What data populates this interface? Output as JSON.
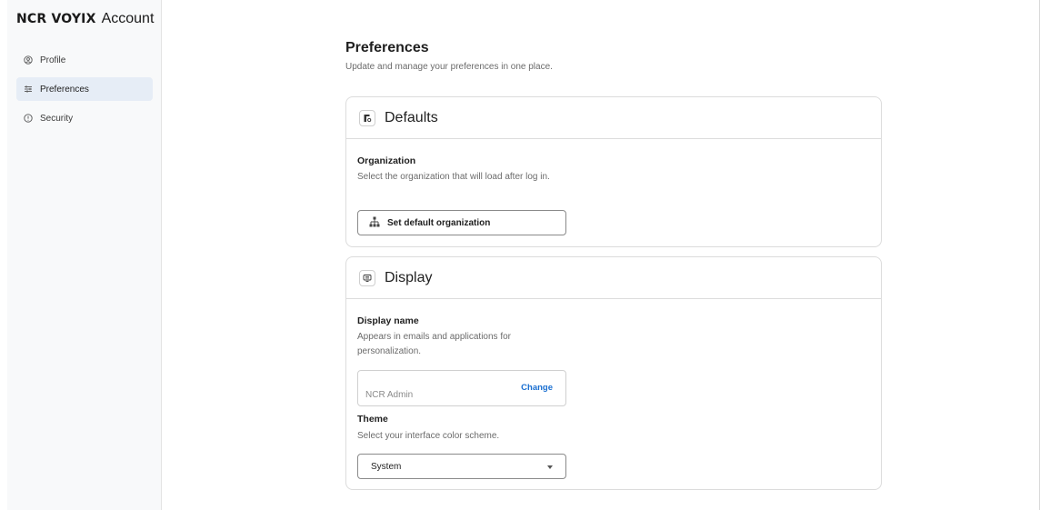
{
  "brand": {
    "logo_text": "NCR VOYIX",
    "name": "Account"
  },
  "sidebar": {
    "items": [
      {
        "label": "Profile",
        "icon": "user-circle-icon",
        "active": false
      },
      {
        "label": "Preferences",
        "icon": "sliders-icon",
        "active": true
      },
      {
        "label": "Security",
        "icon": "shield-icon",
        "active": false
      }
    ]
  },
  "page": {
    "title": "Preferences",
    "subtitle": "Update and manage your preferences in one place."
  },
  "defaults_card": {
    "title": "Defaults",
    "icon": "defaults-icon",
    "organization": {
      "label": "Organization",
      "description": "Select the organization that will load after log in.",
      "button_label": "Set default organization",
      "button_icon": "org-tree-icon"
    }
  },
  "display_card": {
    "title": "Display",
    "icon": "display-icon",
    "display_name": {
      "label": "Display name",
      "description": "Appears in emails and applications for personalization.",
      "value": "NCR Admin",
      "action_label": "Change"
    },
    "theme": {
      "label": "Theme",
      "description": "Select your interface color scheme.",
      "selected": "System"
    }
  },
  "colors": {
    "accent": "#1a6fd1",
    "active_nav_bg": "#e6edf6"
  }
}
